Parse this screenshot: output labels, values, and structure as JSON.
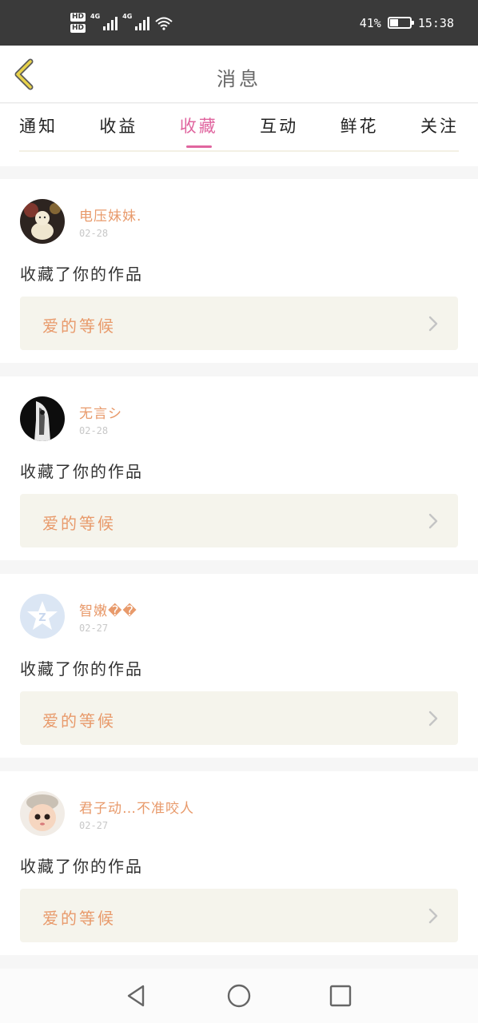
{
  "status_bar": {
    "hd1": "HD",
    "hd2": "HD",
    "net1": "4G",
    "net2": "4G",
    "battery_text": "41%",
    "battery_level": 0.41,
    "time": "15:38"
  },
  "header": {
    "title": "消息",
    "back_icon": "chevron-left-icon"
  },
  "tabs": [
    {
      "label": "通知",
      "active": false
    },
    {
      "label": "收益",
      "active": false
    },
    {
      "label": "收藏",
      "active": true
    },
    {
      "label": "互动",
      "active": false
    },
    {
      "label": "鲜花",
      "active": false
    },
    {
      "label": "关注",
      "active": false
    }
  ],
  "items": [
    {
      "username": "电压妹妹.",
      "date": "02-28",
      "action": "收藏了你的作品",
      "work_title": "爱的等候"
    },
    {
      "username": "无言シ",
      "date": "02-28",
      "action": "收藏了你的作品",
      "work_title": "爱的等候"
    },
    {
      "username": "智嫩��",
      "date": "02-27",
      "action": "收藏了你的作品",
      "work_title": "爱的等候"
    },
    {
      "username": "君子动…不准咬人",
      "date": "02-27",
      "action": "收藏了你的作品",
      "work_title": "爱的等候"
    }
  ],
  "colors": {
    "accent": "#e0659f",
    "username": "#e89a6b",
    "work_bar_bg": "#f5f4ec",
    "back_icon": "#e8d24a"
  },
  "nav_bar": {
    "icons": [
      "back-triangle-icon",
      "home-circle-icon",
      "recents-square-icon"
    ]
  }
}
